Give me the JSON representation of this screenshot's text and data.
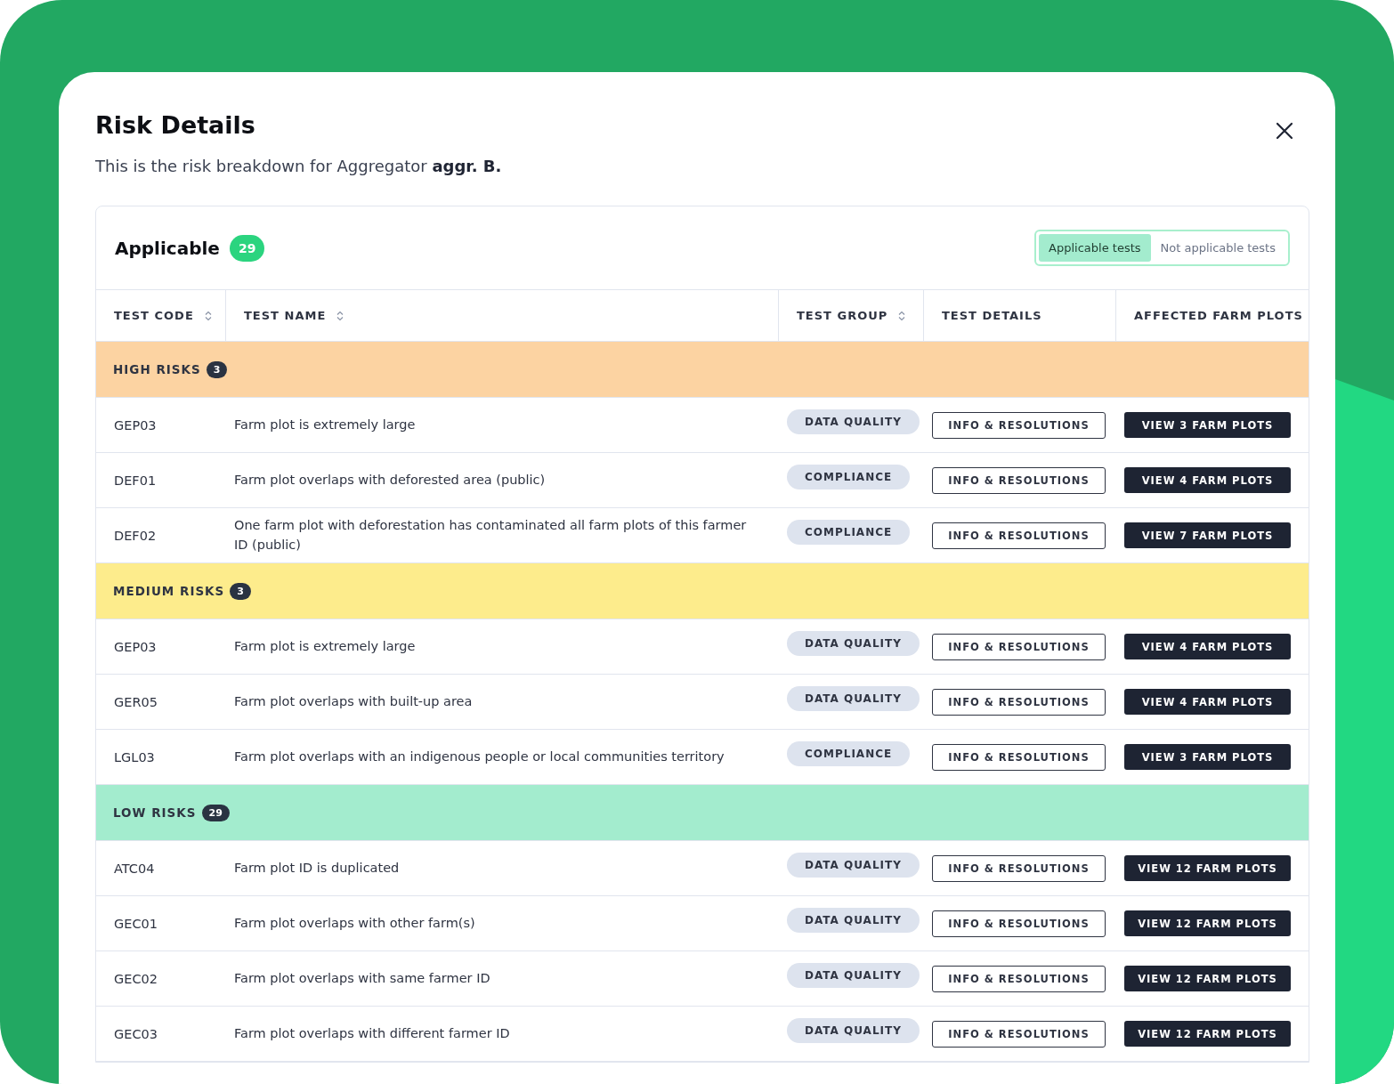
{
  "dialog": {
    "title": "Risk Details",
    "subtitle": "This is the risk breakdown for Aggregator **aggr. B.**"
  },
  "panel": {
    "title": "Applicable",
    "count": "29",
    "filter": [
      {
        "label": "Applicable tests",
        "selected": true
      },
      {
        "label": "Not applicable tests",
        "selected": false
      }
    ]
  },
  "table": {
    "columns": [
      {
        "label": "TEST CODE",
        "sortable": true
      },
      {
        "label": "TEST NAME",
        "sortable": true
      },
      {
        "label": "TEST GROUP",
        "sortable": true
      },
      {
        "label": "TEST DETAILS",
        "sortable": false
      },
      {
        "label": "AFFECTED FARM PLOTS",
        "sortable": false
      }
    ],
    "groups": [
      {
        "label": "HIGH RISKS",
        "count": "3",
        "color": "#fcd3a2",
        "rows": [
          {
            "code": "GEP03",
            "name": "Farm plot is extremely large",
            "group": "DATA QUALITY",
            "details": "INFO & RESOLUTIONS",
            "plots": "VIEW 3 FARM PLOTS"
          },
          {
            "code": "DEF01",
            "name": "Farm plot overlaps with deforested area (public)",
            "group": "COMPLIANCE",
            "details": "INFO & RESOLUTIONS",
            "plots": "VIEW 4 FARM PLOTS"
          },
          {
            "code": "DEF02",
            "name": "One farm plot with deforestation has contaminated all farm plots of this farmer ID (public)",
            "group": "COMPLIANCE",
            "details": "INFO & RESOLUTIONS",
            "plots": "VIEW 7 FARM PLOTS"
          }
        ]
      },
      {
        "label": "MEDIUM RISKS",
        "count": "3",
        "color": "#fdec8c",
        "rows": [
          {
            "code": "GEP03",
            "name": "Farm plot is extremely large",
            "group": "DATA QUALITY",
            "details": "INFO & RESOLUTIONS",
            "plots": "VIEW 4 FARM PLOTS"
          },
          {
            "code": "GER05",
            "name": "Farm plot overlaps with built-up area",
            "group": "DATA QUALITY",
            "details": "INFO & RESOLUTIONS",
            "plots": "VIEW 4 FARM PLOTS"
          },
          {
            "code": "LGL03",
            "name": "Farm plot overlaps with an indigenous people or local communities territory",
            "group": "COMPLIANCE",
            "details": "INFO & RESOLUTIONS",
            "plots": "VIEW 3 FARM PLOTS"
          }
        ]
      },
      {
        "label": "LOW RISKS",
        "count": "29",
        "color": "#a3ecce",
        "rows": [
          {
            "code": "ATC04",
            "name": "Farm plot ID is duplicated",
            "group": "DATA QUALITY",
            "details": "INFO & RESOLUTIONS",
            "plots": "VIEW 12 FARM PLOTS"
          },
          {
            "code": "GEC01",
            "name": "Farm plot overlaps with other farm(s)",
            "group": "DATA QUALITY",
            "details": "INFO & RESOLUTIONS",
            "plots": "VIEW 12 FARM PLOTS"
          },
          {
            "code": "GEC02",
            "name": "Farm plot overlaps with same farmer ID",
            "group": "DATA QUALITY",
            "details": "INFO & RESOLUTIONS",
            "plots": "VIEW 12 FARM PLOTS"
          },
          {
            "code": "GEC03",
            "name": "Farm plot overlaps with different farmer ID",
            "group": "DATA QUALITY",
            "details": "INFO & RESOLUTIONS",
            "plots": "VIEW 12 FARM PLOTS"
          }
        ]
      }
    ]
  }
}
